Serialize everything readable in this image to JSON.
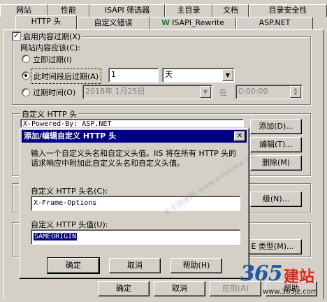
{
  "tabs_row1": [
    "网站",
    "性能",
    "ISAPI 筛选器",
    "主目录",
    "文档",
    "目录安全性"
  ],
  "tabs_row2": [
    "HTTP 头",
    "自定义错误",
    "ISAPI_Rewrite",
    "ASP.NET"
  ],
  "tab_rewrite_icon_char": "W",
  "content_expiration": {
    "checkbox_label": "启用内容过期(X)",
    "checkbox_checked": true,
    "sub_label": "网站内容应该(C):",
    "opt_immediate": "立即过期(I)",
    "opt_after": "此时间段后过期(A)",
    "opt_on": "过期时间(O)",
    "after_value": "1",
    "after_unit": "天",
    "date_value": "2018年 1月25日",
    "at_label": "在",
    "time_value": "0:00:00"
  },
  "custom_headers": {
    "group_label": "自定义 HTTP 头",
    "list_items": [
      "X-Powered-By: ASP.NET"
    ],
    "add_label": "添加(D)...",
    "edit_label": "编辑(T)...",
    "delete_label": "删除(M)"
  },
  "other_buttons": {
    "rating_label": "级(N)...",
    "mime_label": "E 类型(M)...",
    "ok_label": "确定",
    "cancel_label": "取消",
    "apply_label": "应用(A)",
    "help_label": "帮助"
  },
  "dialog": {
    "title": "添加/编辑自定义 HTTP 头",
    "close_glyph": "✕",
    "description": "输入一个自定义头名和自定义头值。IIS 将在所有 HTTP 头的请求响应中附加此自定义头名和自定义头值。",
    "name_label": "自定义 HTTP 头名(C):",
    "name_value": "X-Frame-Options",
    "value_label": "自定义 HTTP 头值(U):",
    "value_value": "SAMEORIGIN",
    "ok_label": "确定",
    "cancel_label": "取消",
    "help_label": "帮助(H)"
  },
  "watermark": {
    "diag_text": "卡卡测速网 www.webkaka.com",
    "logo_365": "365",
    "logo_cn": "建站",
    "logo_url": "www.365jz.com"
  },
  "colors": {
    "face": "#d4d0c8",
    "title_bar": "#000080",
    "selection": "#000080",
    "logo_blue": "#1e5aa8",
    "logo_red": "#d42a1e"
  }
}
